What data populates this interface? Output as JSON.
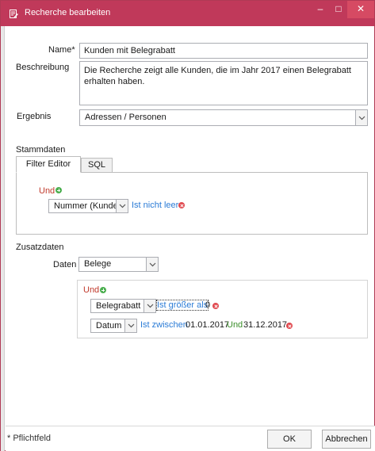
{
  "window": {
    "title": "Recherche bearbeiten",
    "minimize": "–",
    "maximize": "□",
    "close": "✕"
  },
  "form": {
    "name_label": "Name*",
    "name_value": "Kunden mit Belegrabatt",
    "description_label": "Beschreibung",
    "description_value": "Die Recherche zeigt alle Kunden, die im Jahr 2017 einen Belegrabatt erhalten haben.",
    "result_label": "Ergebnis",
    "result_value": "Adressen / Personen"
  },
  "stammdaten": {
    "section_label": "Stammdaten",
    "tabs": [
      {
        "label": "Filter Editor",
        "active": true
      },
      {
        "label": "SQL",
        "active": false
      }
    ],
    "group_operator": "Und",
    "condition": {
      "field": "Nummer (Kunde)",
      "operator": "Ist nicht leer"
    }
  },
  "zusatzdaten": {
    "section_label": "Zusatzdaten",
    "data_label": "Daten",
    "data_value": "Belege",
    "group_operator": "Und",
    "conditions": [
      {
        "field": "Belegrabatt",
        "operator": "Ist größer als",
        "value": "0"
      },
      {
        "field": "Datum",
        "operator": "Ist zwischen",
        "value_from": "01.01.2017",
        "joiner": "Und",
        "value_to": "31.12.2017"
      }
    ]
  },
  "footer": {
    "required_note": "* Pflichtfeld",
    "ok_label": "OK",
    "cancel_label": "Abbrechen"
  },
  "colors": {
    "titlebar": "#c0395a",
    "operator_link": "#2a7bd6",
    "group_operator": "#c0392b",
    "joiner": "#3a8e2a",
    "add_icon": "#4caf50",
    "remove_icon": "#e0484e"
  }
}
